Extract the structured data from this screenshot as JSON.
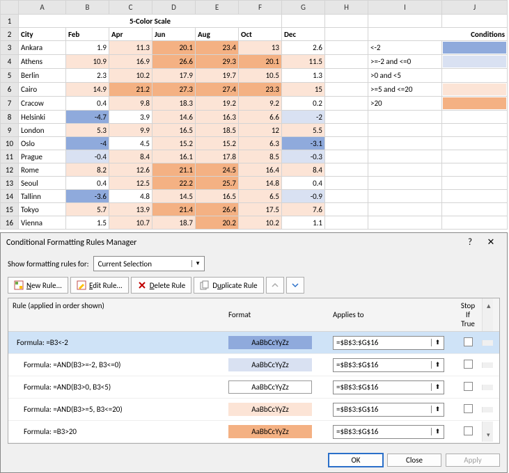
{
  "columns": [
    "A",
    "B",
    "C",
    "D",
    "E",
    "F",
    "G",
    "H",
    "I",
    "J"
  ],
  "row_numbers": [
    1,
    2,
    3,
    4,
    5,
    6,
    7,
    8,
    9,
    10,
    11,
    12,
    13,
    14,
    15,
    16
  ],
  "title": "5-Color Scale",
  "headers": {
    "city": "City",
    "feb": "Feb",
    "apr": "Apr",
    "jun": "Jun",
    "aug": "Aug",
    "oct": "Oct",
    "dec": "Dec",
    "conditions": "Conditions"
  },
  "conditions": [
    {
      "label": "<-2",
      "color": "#8faadc"
    },
    {
      "label": ">=-2 and <=0",
      "color": "#d9e1f2"
    },
    {
      "label": ">0 and <5",
      "color": "#ffffff"
    },
    {
      "label": ">=5 and <=20",
      "color": "#fce4d6"
    },
    {
      "label": ">20",
      "color": "#f4b183"
    }
  ],
  "rows": [
    {
      "city": "Ankara",
      "v": [
        1.9,
        11.3,
        20.1,
        23.4,
        13,
        2.6
      ]
    },
    {
      "city": "Athens",
      "v": [
        10.9,
        16.9,
        26.6,
        29.3,
        20.1,
        11.5
      ]
    },
    {
      "city": "Berlin",
      "v": [
        2.3,
        10.2,
        17.9,
        19.7,
        10.5,
        1.3
      ]
    },
    {
      "city": "Cairo",
      "v": [
        14.9,
        21.2,
        27.3,
        27.4,
        23.3,
        15
      ]
    },
    {
      "city": "Cracow",
      "v": [
        0.4,
        9.8,
        18.3,
        19.2,
        9.2,
        0.2
      ]
    },
    {
      "city": "Helsinki",
      "v": [
        -4.7,
        3.9,
        14.6,
        16.3,
        6.6,
        -2
      ]
    },
    {
      "city": "London",
      "v": [
        5.3,
        9.9,
        16.5,
        18.5,
        12,
        5.5
      ]
    },
    {
      "city": "Oslo",
      "v": [
        -4,
        4.5,
        15.2,
        15.2,
        6.3,
        -3.1
      ]
    },
    {
      "city": "Prague",
      "v": [
        -0.4,
        8.4,
        16.1,
        17.8,
        8.5,
        -0.3
      ]
    },
    {
      "city": "Rome",
      "v": [
        8.2,
        12.6,
        21.1,
        24.5,
        16.4,
        8.4
      ]
    },
    {
      "city": "Seoul",
      "v": [
        0.4,
        12.5,
        22.2,
        25.7,
        14.8,
        0.4
      ]
    },
    {
      "city": "Tallinn",
      "v": [
        -3.6,
        4.8,
        14.5,
        16.5,
        6.5,
        -0.9
      ]
    },
    {
      "city": "Tokyo",
      "v": [
        5.7,
        13.9,
        21.4,
        26.4,
        17.5,
        7.6
      ]
    },
    {
      "city": "Vienna",
      "v": [
        1.5,
        10.7,
        18.7,
        20.2,
        10.2,
        1.1
      ]
    }
  ],
  "chart_data": {
    "type": "table",
    "title": "5-Color Scale",
    "columns": [
      "City",
      "Feb",
      "Apr",
      "Jun",
      "Aug",
      "Oct",
      "Dec"
    ],
    "rows": [
      [
        "Ankara",
        1.9,
        11.3,
        20.1,
        23.4,
        13,
        2.6
      ],
      [
        "Athens",
        10.9,
        16.9,
        26.6,
        29.3,
        20.1,
        11.5
      ],
      [
        "Berlin",
        2.3,
        10.2,
        17.9,
        19.7,
        10.5,
        1.3
      ],
      [
        "Cairo",
        14.9,
        21.2,
        27.3,
        27.4,
        23.3,
        15
      ],
      [
        "Cracow",
        0.4,
        9.8,
        18.3,
        19.2,
        9.2,
        0.2
      ],
      [
        "Helsinki",
        -4.7,
        3.9,
        14.6,
        16.3,
        6.6,
        -2
      ],
      [
        "London",
        5.3,
        9.9,
        16.5,
        18.5,
        12,
        5.5
      ],
      [
        "Oslo",
        -4,
        4.5,
        15.2,
        15.2,
        6.3,
        -3.1
      ],
      [
        "Prague",
        -0.4,
        8.4,
        16.1,
        17.8,
        8.5,
        -0.3
      ],
      [
        "Rome",
        8.2,
        12.6,
        21.1,
        24.5,
        16.4,
        8.4
      ],
      [
        "Seoul",
        0.4,
        12.5,
        22.2,
        25.7,
        14.8,
        0.4
      ],
      [
        "Tallinn",
        -3.6,
        4.8,
        14.5,
        16.5,
        6.5,
        -0.9
      ],
      [
        "Tokyo",
        5.7,
        13.9,
        21.4,
        26.4,
        17.5,
        7.6
      ],
      [
        "Vienna",
        1.5,
        10.7,
        18.7,
        20.2,
        10.2,
        1.1
      ]
    ],
    "color_scale": [
      {
        "rule": "<-2",
        "color": "#8faadc"
      },
      {
        "rule": ">=-2 and <=0",
        "color": "#d9e1f2"
      },
      {
        "rule": ">0 and <5",
        "color": "#ffffff"
      },
      {
        "rule": ">=5 and <=20",
        "color": "#fce4d6"
      },
      {
        "rule": ">20",
        "color": "#f4b183"
      }
    ]
  },
  "dialog": {
    "title": "Conditional Formatting Rules Manager",
    "help": "?",
    "close": "✕",
    "show_label": "Show formatting rules for:",
    "show_value": "Current Selection",
    "buttons": {
      "new": "New Rule...",
      "edit": "Edit Rule...",
      "delete": "Delete Rule",
      "duplicate": "Duplicate Rule"
    },
    "col_headers": {
      "rule": "Rule (applied in order shown)",
      "format": "Format",
      "applies": "Applies to",
      "stop": "Stop If True"
    },
    "format_sample": "AaBbCcYyZz",
    "rules": [
      {
        "formula": "Formula: =B3<-2",
        "color": "#8faadc",
        "applies": "=$B$3:$G$16",
        "selected": true
      },
      {
        "formula": "Formula: =AND(B3>=-2, B3<=0)",
        "color": "#d9e1f2",
        "applies": "=$B$3:$G$16",
        "selected": false
      },
      {
        "formula": "Formula: =AND(B3>0, B3<5)",
        "color": "#ffffff",
        "applies": "=$B$3:$G$16",
        "selected": false
      },
      {
        "formula": "Formula: =AND(B3>=5, B3<=20)",
        "color": "#fce4d6",
        "applies": "=$B$3:$G$16",
        "selected": false
      },
      {
        "formula": "Formula: =B3>20",
        "color": "#f4b183",
        "applies": "=$B$3:$G$16",
        "selected": false
      }
    ],
    "footer": {
      "ok": "OK",
      "close": "Close",
      "apply": "Apply"
    }
  }
}
